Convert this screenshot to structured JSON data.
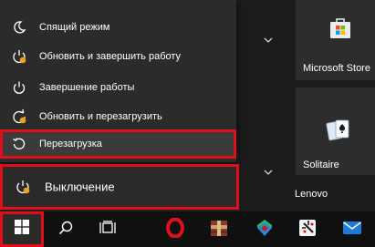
{
  "power_menu": {
    "items": [
      {
        "label": "Спящий режим",
        "icon": "moon-icon"
      },
      {
        "label": "Обновить и завершить работу",
        "icon": "update-power-icon"
      },
      {
        "label": "Завершение работы",
        "icon": "power-icon"
      },
      {
        "label": "Обновить и перезагрузить",
        "icon": "update-restart-icon"
      },
      {
        "label": "Перезагрузка",
        "icon": "restart-icon"
      }
    ],
    "power_label": "Выключение"
  },
  "tiles": {
    "store_label": "Microsoft Store",
    "solitaire_label": "Solitaire",
    "group_label": "Lenovo"
  },
  "taskbar": {
    "icons": [
      "windows-logo-icon",
      "search-icon",
      "task-view-icon",
      "opera-icon",
      "archive-icon",
      "vpn-icon",
      "snipping-icon",
      "mail-icon"
    ]
  },
  "colors": {
    "highlight": "#e0101a",
    "update_badge": "#f0a020"
  }
}
